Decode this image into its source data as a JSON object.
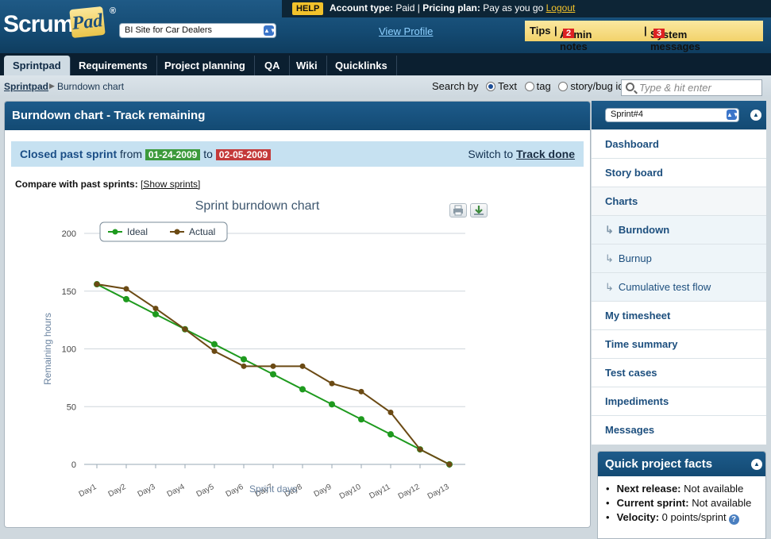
{
  "header": {
    "logo_main": "Scrum",
    "logo_pad": "Pad",
    "logo_reg": "®",
    "help_label": "HELP",
    "account_label": "Account type:",
    "account_value": "Paid",
    "pricing_label": "Pricing plan:",
    "pricing_value": "Pay as you go",
    "logout": "Logout",
    "project_select": "BI Site for Car Dealers",
    "view_profile": "View Profile",
    "tips": "Tips",
    "admin_notes": "Admin notes",
    "admin_notes_count": "2",
    "system_messages": "System messages",
    "system_messages_count": "3"
  },
  "nav": {
    "tabs": [
      "Sprintpad",
      "Requirements",
      "Project planning",
      "QA",
      "Wiki",
      "Quicklinks"
    ]
  },
  "breadcrumb": {
    "root": "Sprintpad",
    "current": "Burndown chart"
  },
  "search": {
    "label": "Search by",
    "options": [
      "Text",
      "tag",
      "story/bug id"
    ],
    "selected": "Text",
    "placeholder": "Type & hit enter"
  },
  "main": {
    "title": "Burndown chart - Track remaining",
    "closed_label": "Closed past sprint",
    "from_label": "from",
    "from_date": "01-24-2009",
    "to_label": "to",
    "to_date": "02-05-2009",
    "switch_label": "Switch to",
    "switch_link": "Track done",
    "compare_label": "Compare with past sprints:",
    "compare_link": "[Show sprints]"
  },
  "chart_data": {
    "type": "line",
    "title": "Sprint burndown chart",
    "xlabel": "Sprint days",
    "ylabel": "Remaining hours",
    "ylim": [
      0,
      200
    ],
    "yticks": [
      0,
      50,
      100,
      150,
      200
    ],
    "categories": [
      "Day1",
      "Day2",
      "Day3",
      "Day4",
      "Day5",
      "Day6",
      "Day7",
      "Day8",
      "Day9",
      "Day10",
      "Day11",
      "Day12",
      "Day13"
    ],
    "legend_position": "top-left",
    "series": [
      {
        "name": "Ideal",
        "color": "#1e9a1e",
        "values": [
          156,
          143,
          130,
          117,
          104,
          91,
          78,
          65,
          52,
          39,
          26,
          13,
          0
        ]
      },
      {
        "name": "Actual",
        "color": "#6b4a14",
        "values": [
          156,
          152,
          135,
          117,
          98,
          85,
          85,
          85,
          70,
          63,
          45,
          13,
          0
        ]
      }
    ]
  },
  "sidebar": {
    "sprint_select": "Sprint#4",
    "items": [
      "Dashboard",
      "Story board",
      "Charts"
    ],
    "subitems": [
      "Burndown",
      "Burnup",
      "Cumulative test flow"
    ],
    "items_after": [
      "My timesheet",
      "Time summary",
      "Test cases",
      "Impediments",
      "Messages"
    ]
  },
  "facts": {
    "title": "Quick project facts",
    "rows": [
      {
        "label": "Next release:",
        "value": "Not available"
      },
      {
        "label": "Current sprint:",
        "value": "Not available"
      },
      {
        "label": "Velocity:",
        "value": "0 points/sprint"
      }
    ]
  }
}
